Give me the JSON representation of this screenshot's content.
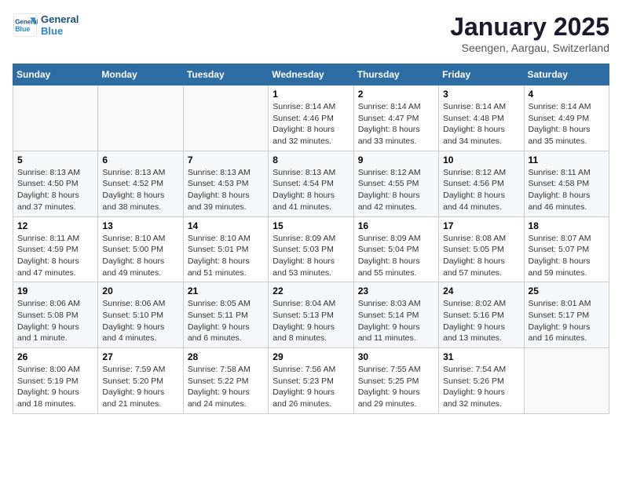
{
  "header": {
    "logo_line1": "General",
    "logo_line2": "Blue",
    "month": "January 2025",
    "location": "Seengen, Aargau, Switzerland"
  },
  "weekdays": [
    "Sunday",
    "Monday",
    "Tuesday",
    "Wednesday",
    "Thursday",
    "Friday",
    "Saturday"
  ],
  "weeks": [
    [
      {
        "day": "",
        "info": ""
      },
      {
        "day": "",
        "info": ""
      },
      {
        "day": "",
        "info": ""
      },
      {
        "day": "1",
        "info": "Sunrise: 8:14 AM\nSunset: 4:46 PM\nDaylight: 8 hours\nand 32 minutes."
      },
      {
        "day": "2",
        "info": "Sunrise: 8:14 AM\nSunset: 4:47 PM\nDaylight: 8 hours\nand 33 minutes."
      },
      {
        "day": "3",
        "info": "Sunrise: 8:14 AM\nSunset: 4:48 PM\nDaylight: 8 hours\nand 34 minutes."
      },
      {
        "day": "4",
        "info": "Sunrise: 8:14 AM\nSunset: 4:49 PM\nDaylight: 8 hours\nand 35 minutes."
      }
    ],
    [
      {
        "day": "5",
        "info": "Sunrise: 8:13 AM\nSunset: 4:50 PM\nDaylight: 8 hours\nand 37 minutes."
      },
      {
        "day": "6",
        "info": "Sunrise: 8:13 AM\nSunset: 4:52 PM\nDaylight: 8 hours\nand 38 minutes."
      },
      {
        "day": "7",
        "info": "Sunrise: 8:13 AM\nSunset: 4:53 PM\nDaylight: 8 hours\nand 39 minutes."
      },
      {
        "day": "8",
        "info": "Sunrise: 8:13 AM\nSunset: 4:54 PM\nDaylight: 8 hours\nand 41 minutes."
      },
      {
        "day": "9",
        "info": "Sunrise: 8:12 AM\nSunset: 4:55 PM\nDaylight: 8 hours\nand 42 minutes."
      },
      {
        "day": "10",
        "info": "Sunrise: 8:12 AM\nSunset: 4:56 PM\nDaylight: 8 hours\nand 44 minutes."
      },
      {
        "day": "11",
        "info": "Sunrise: 8:11 AM\nSunset: 4:58 PM\nDaylight: 8 hours\nand 46 minutes."
      }
    ],
    [
      {
        "day": "12",
        "info": "Sunrise: 8:11 AM\nSunset: 4:59 PM\nDaylight: 8 hours\nand 47 minutes."
      },
      {
        "day": "13",
        "info": "Sunrise: 8:10 AM\nSunset: 5:00 PM\nDaylight: 8 hours\nand 49 minutes."
      },
      {
        "day": "14",
        "info": "Sunrise: 8:10 AM\nSunset: 5:01 PM\nDaylight: 8 hours\nand 51 minutes."
      },
      {
        "day": "15",
        "info": "Sunrise: 8:09 AM\nSunset: 5:03 PM\nDaylight: 8 hours\nand 53 minutes."
      },
      {
        "day": "16",
        "info": "Sunrise: 8:09 AM\nSunset: 5:04 PM\nDaylight: 8 hours\nand 55 minutes."
      },
      {
        "day": "17",
        "info": "Sunrise: 8:08 AM\nSunset: 5:05 PM\nDaylight: 8 hours\nand 57 minutes."
      },
      {
        "day": "18",
        "info": "Sunrise: 8:07 AM\nSunset: 5:07 PM\nDaylight: 8 hours\nand 59 minutes."
      }
    ],
    [
      {
        "day": "19",
        "info": "Sunrise: 8:06 AM\nSunset: 5:08 PM\nDaylight: 9 hours\nand 1 minute."
      },
      {
        "day": "20",
        "info": "Sunrise: 8:06 AM\nSunset: 5:10 PM\nDaylight: 9 hours\nand 4 minutes."
      },
      {
        "day": "21",
        "info": "Sunrise: 8:05 AM\nSunset: 5:11 PM\nDaylight: 9 hours\nand 6 minutes."
      },
      {
        "day": "22",
        "info": "Sunrise: 8:04 AM\nSunset: 5:13 PM\nDaylight: 9 hours\nand 8 minutes."
      },
      {
        "day": "23",
        "info": "Sunrise: 8:03 AM\nSunset: 5:14 PM\nDaylight: 9 hours\nand 11 minutes."
      },
      {
        "day": "24",
        "info": "Sunrise: 8:02 AM\nSunset: 5:16 PM\nDaylight: 9 hours\nand 13 minutes."
      },
      {
        "day": "25",
        "info": "Sunrise: 8:01 AM\nSunset: 5:17 PM\nDaylight: 9 hours\nand 16 minutes."
      }
    ],
    [
      {
        "day": "26",
        "info": "Sunrise: 8:00 AM\nSunset: 5:19 PM\nDaylight: 9 hours\nand 18 minutes."
      },
      {
        "day": "27",
        "info": "Sunrise: 7:59 AM\nSunset: 5:20 PM\nDaylight: 9 hours\nand 21 minutes."
      },
      {
        "day": "28",
        "info": "Sunrise: 7:58 AM\nSunset: 5:22 PM\nDaylight: 9 hours\nand 24 minutes."
      },
      {
        "day": "29",
        "info": "Sunrise: 7:56 AM\nSunset: 5:23 PM\nDaylight: 9 hours\nand 26 minutes."
      },
      {
        "day": "30",
        "info": "Sunrise: 7:55 AM\nSunset: 5:25 PM\nDaylight: 9 hours\nand 29 minutes."
      },
      {
        "day": "31",
        "info": "Sunrise: 7:54 AM\nSunset: 5:26 PM\nDaylight: 9 hours\nand 32 minutes."
      },
      {
        "day": "",
        "info": ""
      }
    ]
  ]
}
